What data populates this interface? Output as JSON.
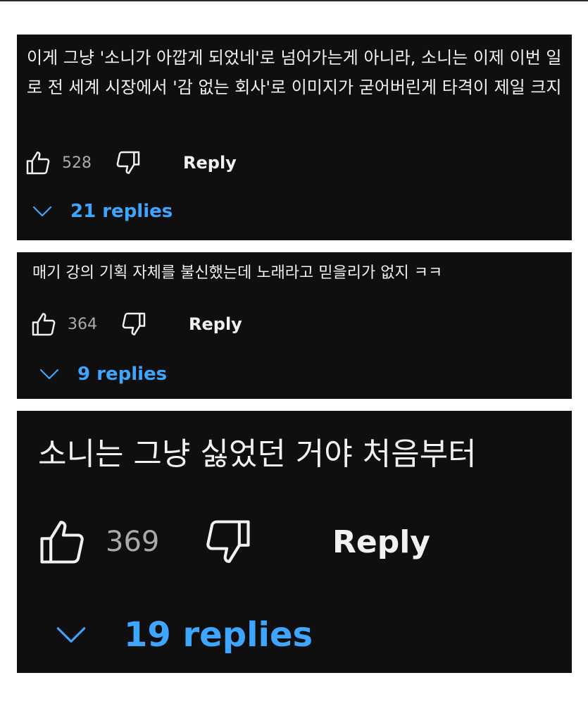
{
  "theme": {
    "background": "#0f0f0f",
    "text": "#f1f1f1",
    "muted": "#aaaaaa",
    "link": "#3ea6ff"
  },
  "comments": [
    {
      "text": "이게 그냥 '소니가 아깝게 되었네'로 넘어가는게 아니라, 소니는 이제 이번 일로 전 세계 시장에서 '감 없는 회사'로 이미지가 굳어버린게 타격이 제일 크지",
      "likes": "528",
      "reply_label": "Reply",
      "replies_label": "21 replies",
      "like_icon": "thumbs-up-icon",
      "dislike_icon": "thumbs-down-icon",
      "expand_icon": "chevron-down-icon"
    },
    {
      "text": "매기 강의 기획 자체를 불신했는데 노래라고 믿을리가 없지 ㅋㅋ",
      "likes": "364",
      "reply_label": "Reply",
      "replies_label": "9 replies",
      "like_icon": "thumbs-up-icon",
      "dislike_icon": "thumbs-down-icon",
      "expand_icon": "chevron-down-icon"
    },
    {
      "text": "소니는 그냥 싫었던 거야 처음부터",
      "likes": "369",
      "reply_label": "Reply",
      "replies_label": "19 replies",
      "like_icon": "thumbs-up-icon",
      "dislike_icon": "thumbs-down-icon",
      "expand_icon": "chevron-down-icon"
    }
  ]
}
